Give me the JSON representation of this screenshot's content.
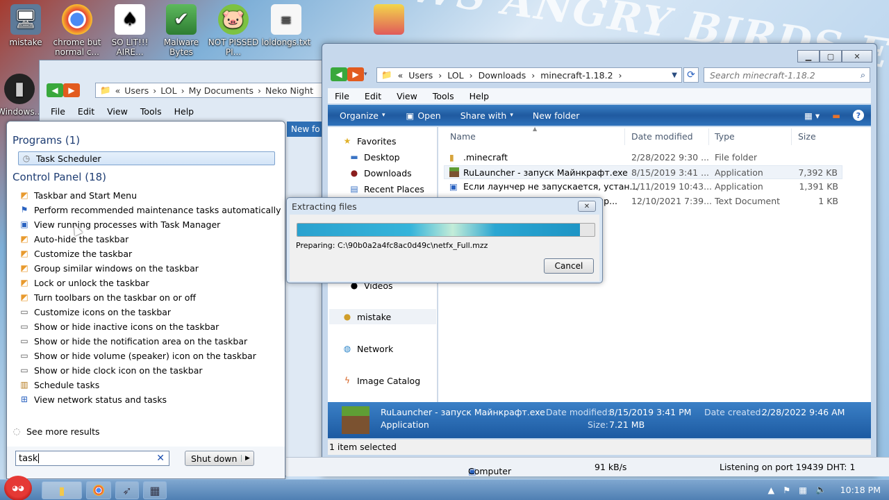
{
  "wallpaper": {
    "text": "...OWS ANGRY BIRDS E..."
  },
  "desktop_icons": [
    {
      "label": "mistake",
      "icon": "computer-icon"
    },
    {
      "label": "chrome but normal c...",
      "icon": "chrome-icon"
    },
    {
      "label": "SO LIT!!! AIRE...",
      "icon": "cards-icon"
    },
    {
      "label": "Malware Bytes",
      "icon": "shield-icon"
    },
    {
      "label": "NOT PISSED PI...",
      "icon": "pig-icon"
    },
    {
      "label": "loldongs.txt",
      "icon": "text-file-icon"
    },
    {
      "label": "",
      "icon": "image-icon"
    },
    {
      "label": "Windows...",
      "icon": "bin-icon"
    }
  ],
  "bg_window": {
    "breadcrumb": [
      "Users",
      "LOL",
      "My Documents",
      "Neko Night"
    ],
    "menu": [
      "File",
      "Edit",
      "View",
      "Tools",
      "Help"
    ],
    "partial_text": "New fo"
  },
  "start_menu": {
    "programs_header": "Programs (1)",
    "programs": [
      {
        "label": "Task Scheduler",
        "icon": "clock-icon"
      }
    ],
    "control_panel_header": "Control Panel (18)",
    "control_panel": [
      {
        "label": "Taskbar and Start Menu",
        "icon": "taskbar-icon"
      },
      {
        "label": "Perform recommended maintenance tasks automatically",
        "icon": "flag-icon"
      },
      {
        "label": "View running processes with Task Manager",
        "icon": "monitor-icon"
      },
      {
        "label": "Auto-hide the taskbar",
        "icon": "taskbar-icon"
      },
      {
        "label": "Customize the taskbar",
        "icon": "taskbar-icon"
      },
      {
        "label": "Group similar windows on the taskbar",
        "icon": "taskbar-icon"
      },
      {
        "label": "Lock or unlock the taskbar",
        "icon": "taskbar-icon"
      },
      {
        "label": "Turn toolbars on the taskbar on or off",
        "icon": "taskbar-icon"
      },
      {
        "label": "Customize icons on the taskbar",
        "icon": "notification-icon"
      },
      {
        "label": "Show or hide inactive icons on the taskbar",
        "icon": "notification-icon"
      },
      {
        "label": "Show or hide the notification area on the taskbar",
        "icon": "notification-icon"
      },
      {
        "label": "Show or hide volume (speaker) icon on the taskbar",
        "icon": "notification-icon"
      },
      {
        "label": "Show or hide clock icon on the taskbar",
        "icon": "notification-icon"
      },
      {
        "label": "Schedule tasks",
        "icon": "tools-icon"
      },
      {
        "label": "View network status and tasks",
        "icon": "network-icon"
      }
    ],
    "see_more": "See more results",
    "search_value": "task",
    "shutdown_label": "Shut down"
  },
  "explorer": {
    "breadcrumb": [
      "Users",
      "LOL",
      "Downloads",
      "minecraft-1.18.2"
    ],
    "search_placeholder": "Search minecraft-1.18.2",
    "menu": [
      "File",
      "Edit",
      "View",
      "Tools",
      "Help"
    ],
    "commands": {
      "organize": "Organize",
      "open": "Open",
      "share": "Share with",
      "new_folder": "New folder"
    },
    "nav": {
      "favorites": "Favorites",
      "desktop": "Desktop",
      "downloads": "Downloads",
      "recent": "Recent Places",
      "videos": "Videos",
      "mistake": "mistake",
      "network": "Network",
      "image_catalog": "Image Catalog"
    },
    "columns": {
      "name": "Name",
      "date": "Date modified",
      "type": "Type",
      "size": "Size"
    },
    "files": [
      {
        "name": ".minecraft",
        "date": "2/28/2022 9:30 ...",
        "type": "File folder",
        "size": "",
        "icon": "folder-icon"
      },
      {
        "name": "RuLauncher - запуск Майнкрафт.exe",
        "date": "8/15/2019 3:41 ...",
        "type": "Application",
        "size": "7,392 KB",
        "icon": "grass-block-icon"
      },
      {
        "name": "Если лаунчер не запускается, устан...",
        "date": "1/11/2019 10:43...",
        "type": "Application",
        "size": "1,391 KB",
        "icon": "installer-icon"
      },
      {
        "name": "пр...",
        "date": "12/10/2021 7:39...",
        "type": "Text Document",
        "size": "1 KB",
        "icon": "text-file-icon"
      }
    ],
    "details": {
      "name": "RuLauncher - запуск Майнкрафт.exe",
      "type": "Application",
      "date_modified_label": "Date modified:",
      "date_modified": "8/15/2019 3:41 PM",
      "size_label": "Size:",
      "size": "7.21 MB",
      "date_created_label": "Date created:",
      "date_created": "2/28/2022 9:46 AM"
    },
    "status": "1 item selected"
  },
  "lower_bar": {
    "computer": "Computer",
    "speed": "91 kB/s",
    "port": "Listening on port 19439",
    "dht": "DHT: 1"
  },
  "dialog": {
    "title": "Extracting files",
    "progress": 0.95,
    "message": "Preparing: C:\\90b0a2a4fc8ac0d49c\\netfx_Full.mzz",
    "cancel": "Cancel"
  },
  "taskbar": {
    "time": "10:18 PM",
    "buttons": [
      "explorer-icon",
      "chrome-icon",
      "rocket-icon",
      "network-tool-icon"
    ]
  }
}
